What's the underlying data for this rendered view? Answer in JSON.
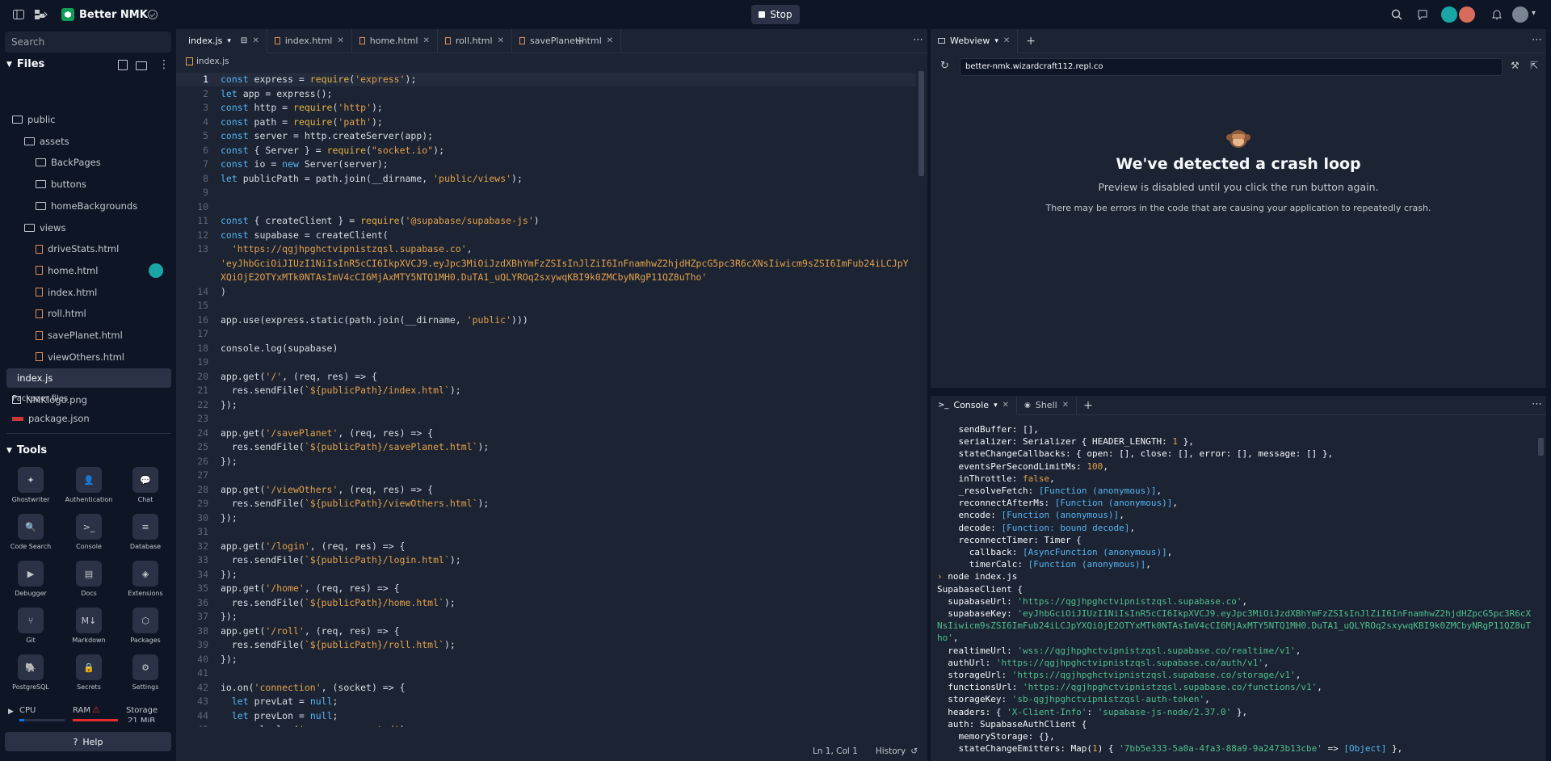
{
  "app": {
    "project_name": "Better NMK",
    "stop_label": "Stop"
  },
  "sidebar": {
    "search_placeholder": "Search",
    "files_label": "Files",
    "tree": [
      {
        "label": "public",
        "type": "folder",
        "depth": 0
      },
      {
        "label": "assets",
        "type": "folder",
        "depth": 1
      },
      {
        "label": "BackPages",
        "type": "folder",
        "depth": 2
      },
      {
        "label": "buttons",
        "type": "folder",
        "depth": 2
      },
      {
        "label": "homeBackgrounds",
        "type": "folder",
        "depth": 2
      },
      {
        "label": "views",
        "type": "folder",
        "depth": 1
      },
      {
        "label": "driveStats.html",
        "type": "html",
        "depth": 2
      },
      {
        "label": "home.html",
        "type": "html",
        "depth": 2
      },
      {
        "label": "index.html",
        "type": "html",
        "depth": 2
      },
      {
        "label": "roll.html",
        "type": "html",
        "depth": 2
      },
      {
        "label": "savePlanet.html",
        "type": "html",
        "depth": 2
      },
      {
        "label": "viewOthers.html",
        "type": "html",
        "depth": 2
      },
      {
        "label": "index.js",
        "type": "js",
        "depth": 0,
        "selected": true
      },
      {
        "label": "NMKlogo.png",
        "type": "image",
        "depth": 0
      }
    ],
    "packager_label": "Packager files",
    "package_json": "package.json",
    "tools_label": "Tools",
    "tools": [
      "Ghostwriter",
      "Authentication",
      "Chat",
      "Code Search",
      "Console",
      "Database",
      "Debugger",
      "Docs",
      "Extensions",
      "Git",
      "Markdown",
      "Packages",
      "PostgreSQL",
      "Secrets",
      "Settings"
    ],
    "resources": {
      "cpu": "CPU",
      "ram": "RAM",
      "storage": "Storage",
      "storage_value": "21 MiB"
    },
    "help_label": "Help"
  },
  "editor": {
    "tabs": [
      "index.js",
      "index.html",
      "home.html",
      "roll.html",
      "savePlanet.html"
    ],
    "breadcrumb": "index.js",
    "status_position": "Ln 1, Col 1",
    "status_history": "History",
    "lines": [
      {
        "n": "1",
        "t": "const express = require('express');"
      },
      {
        "n": "2",
        "t": "let app = express();"
      },
      {
        "n": "3",
        "t": "const http = require('http');"
      },
      {
        "n": "4",
        "t": "const path = require('path');"
      },
      {
        "n": "5",
        "t": "const server = http.createServer(app);"
      },
      {
        "n": "6",
        "t": "const { Server } = require(\"socket.io\");"
      },
      {
        "n": "7",
        "t": "const io = new Server(server);"
      },
      {
        "n": "8",
        "t": "let publicPath = path.join(__dirname, 'public/views');"
      },
      {
        "n": "9",
        "t": ""
      },
      {
        "n": "10",
        "t": ""
      },
      {
        "n": "11",
        "t": "const { createClient } = require('@supabase/supabase-js')"
      },
      {
        "n": "12",
        "t": "const supabase = createClient("
      },
      {
        "n": "13",
        "t": "  'https://qgjhpghctvipnistzqsl.supabase.co',"
      },
      {
        "n": "",
        "t": "'eyJhbGciOiJIUzI1NiIsInR5cCI6IkpXVCJ9.eyJpc3MiOiJzdXBhYmFzZSIsInJlZiI6InFnamhwZ2hjdHZpcG5pc3R6cXNsIiwicm9sZSI6ImFub24iLCJpYXQiOjE2OTYxMTk0NTAsImV4cCI6MjAxMTY5NTQ1MH0.DuTA1_uQLYROq2sxywqKBI9k0ZMCbyNRgP11QZ8uTho'"
      },
      {
        "n": "14",
        "t": ")"
      },
      {
        "n": "15",
        "t": ""
      },
      {
        "n": "16",
        "t": "app.use(express.static(path.join(__dirname, 'public')))"
      },
      {
        "n": "17",
        "t": ""
      },
      {
        "n": "18",
        "t": "console.log(supabase)"
      },
      {
        "n": "19",
        "t": ""
      },
      {
        "n": "20",
        "t": "app.get('/', (req, res) => {"
      },
      {
        "n": "21",
        "t": "  res.sendFile(`${publicPath}/index.html`);"
      },
      {
        "n": "22",
        "t": "});"
      },
      {
        "n": "23",
        "t": ""
      },
      {
        "n": "24",
        "t": "app.get('/savePlanet', (req, res) => {"
      },
      {
        "n": "25",
        "t": "  res.sendFile(`${publicPath}/savePlanet.html`);"
      },
      {
        "n": "26",
        "t": "});"
      },
      {
        "n": "27",
        "t": ""
      },
      {
        "n": "28",
        "t": "app.get('/viewOthers', (req, res) => {"
      },
      {
        "n": "29",
        "t": "  res.sendFile(`${publicPath}/viewOthers.html`);"
      },
      {
        "n": "30",
        "t": "});"
      },
      {
        "n": "31",
        "t": ""
      },
      {
        "n": "32",
        "t": "app.get('/login', (req, res) => {"
      },
      {
        "n": "33",
        "t": "  res.sendFile(`${publicPath}/login.html`);"
      },
      {
        "n": "34",
        "t": "});"
      },
      {
        "n": "35",
        "t": "app.get('/home', (req, res) => {"
      },
      {
        "n": "36",
        "t": "  res.sendFile(`${publicPath}/home.html`);"
      },
      {
        "n": "37",
        "t": "});"
      },
      {
        "n": "38",
        "t": "app.get('/roll', (req, res) => {"
      },
      {
        "n": "39",
        "t": "  res.sendFile(`${publicPath}/roll.html`);"
      },
      {
        "n": "40",
        "t": "});"
      },
      {
        "n": "41",
        "t": ""
      },
      {
        "n": "42",
        "t": "io.on('connection', (socket) => {"
      },
      {
        "n": "43",
        "t": "  let prevLat = null;"
      },
      {
        "n": "44",
        "t": "  let prevLon = null;"
      },
      {
        "n": "45",
        "t": "  console.log('a user connected');"
      }
    ]
  },
  "webview": {
    "tab_label": "Webview",
    "url": "better-nmk.wizardcraft112.repl.co",
    "crash_title": "We've detected a crash loop",
    "crash_subtitle": "Preview is disabled until you click the run button again.",
    "crash_detail": "There may be errors in the code that are causing your application to repeatedly crash."
  },
  "console": {
    "tabs": [
      "Console",
      "Shell"
    ],
    "lines": [
      "    sendBuffer: [],",
      "    serializer: Serializer { HEADER_LENGTH: 1 },",
      "    stateChangeCallbacks: { open: [], close: [], error: [], message: [] },",
      "    eventsPerSecondLimitMs: 100,",
      "    inThrottle: false,",
      "    _resolveFetch: [Function (anonymous)],",
      "    reconnectAfterMs: [Function (anonymous)],",
      "    encode: [Function (anonymous)],",
      "    decode: [Function: bound decode],",
      "    reconnectTimer: Timer {",
      "      callback: [AsyncFunction (anonymous)],",
      "      timerCalc: [Function (anonymous)],",
      "› node index.js",
      "SupabaseClient {",
      "  supabaseUrl: 'https://qgjhpghctvipnistzqsl.supabase.co',",
      "  supabaseKey: 'eyJhbGciOiJIUzI1NiIsInR5cCI6IkpXVCJ9.eyJpc3MiOiJzdXBhYmFzZSIsInJlZiI6InFnamhwZ2hjdHZpcG5pc3R6cXNsIiwicm9sZSI6ImFub24iLCJpYXQiOjE2OTYxMTk0NTAsImV4cCI6MjAxMTY5NTQ1MH0.DuTA1_uQLYROq2sxywqKBI9k0ZMCbyNRgP11QZ8uTho',",
      "  realtimeUrl: 'wss://qgjhpghctvipnistzqsl.supabase.co/realtime/v1',",
      "  authUrl: 'https://qgjhpghctvipnistzqsl.supabase.co/auth/v1',",
      "  storageUrl: 'https://qgjhpghctvipnistzqsl.supabase.co/storage/v1',",
      "  functionsUrl: 'https://qgjhpghctvipnistzqsl.supabase.co/functions/v1',",
      "  storageKey: 'sb-qgjhpghctvipnistzqsl-auth-token',",
      "  headers: { 'X-Client-Info': 'supabase-js-node/2.37.0' },",
      "  auth: SupabaseAuthClient {",
      "    memoryStorage: {},",
      "    stateChangeEmitters: Map(1) { '7bb5e333-5a0a-4fa3-88a9-9a2473b13cbe' => [Object] },"
    ]
  },
  "colors": {
    "bg": "#0e1525",
    "panel": "#1c2333",
    "accent": "#0079f2",
    "string": "#e3a24a",
    "console_string": "#4fc08d"
  }
}
